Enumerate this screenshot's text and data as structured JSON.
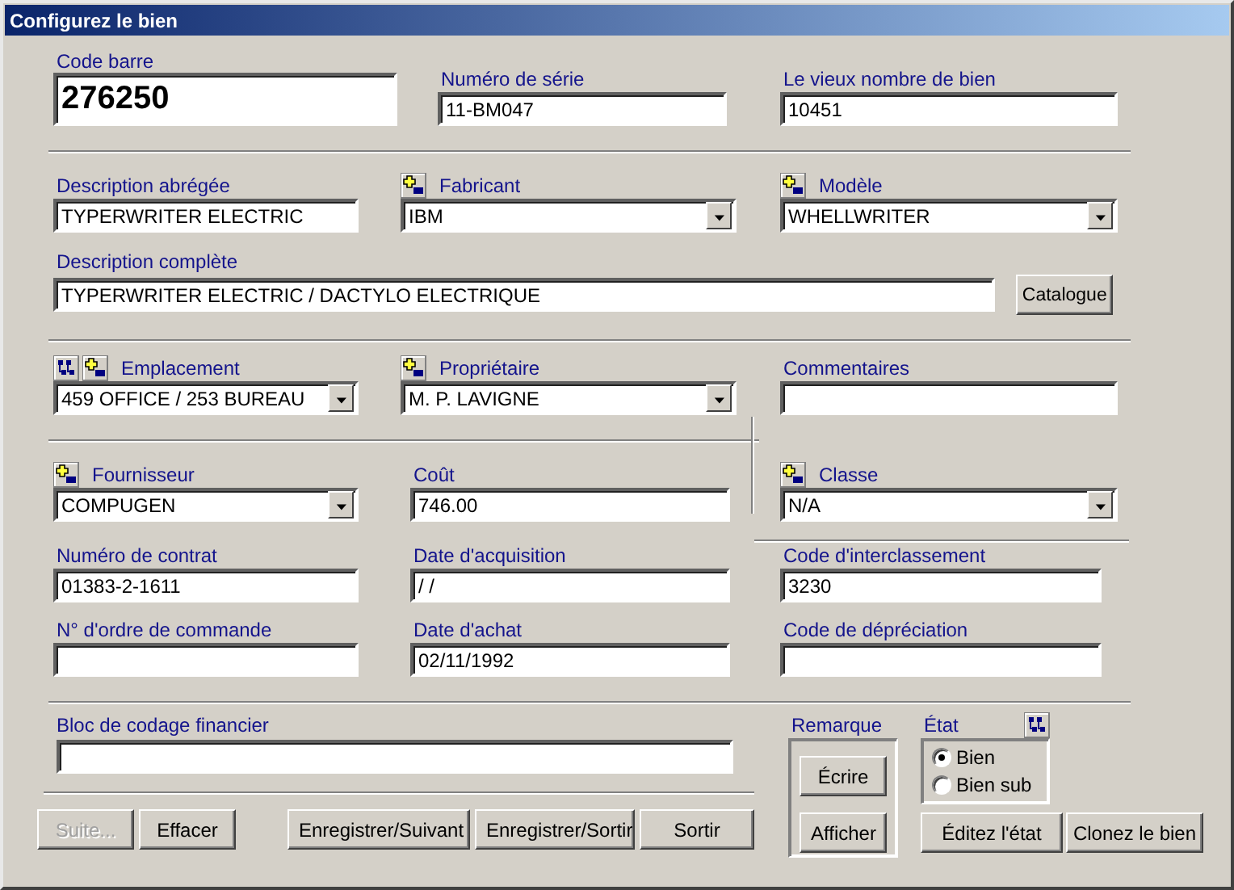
{
  "window": {
    "title": "Configurez le bien"
  },
  "sections": [
    {
      "rows": [
        [
          {
            "label": "Code barre",
            "kind": "barcode",
            "value": "276250"
          },
          {
            "label": "Numéro de série",
            "kind": "text",
            "value": "11-BM047"
          },
          {
            "label": "Le vieux nombre de bien",
            "kind": "text",
            "value": "10451"
          }
        ]
      ]
    },
    {
      "rows": [
        [
          {
            "label": "Description abrégée",
            "kind": "text",
            "value": "TYPERWRITER ELECTRIC"
          },
          {
            "label": "Fabricant",
            "kind": "combo",
            "value": "IBM",
            "add_remove": true
          },
          {
            "label": "Modèle",
            "kind": "combo",
            "value": "WHELLWRITER",
            "add_remove": true
          }
        ],
        [
          {
            "label": "Description complète",
            "kind": "wide",
            "value": "TYPERWRITER ELECTRIC / DACTYLO ELECTRIQUE",
            "button": "Catalogue"
          }
        ]
      ]
    },
    {
      "rows": [
        [
          {
            "label": "Emplacement",
            "kind": "combo",
            "value": "459 OFFICE / 253 BUREAU",
            "hierarchy": true,
            "add_remove": true
          },
          {
            "label": "Propriétaire",
            "kind": "combo",
            "value": "M. P. LAVIGNE",
            "add_remove": true
          },
          {
            "label": "Commentaires",
            "kind": "text"
          }
        ]
      ]
    },
    {
      "rows": [
        [
          {
            "label": "Fournisseur",
            "kind": "combo",
            "value": "COMPUGEN",
            "add_remove": true
          },
          {
            "label": "Coût",
            "kind": "text",
            "value": "746.00"
          },
          {
            "label": "Classe",
            "kind": "combo",
            "value": "N/A",
            "add_remove": true
          }
        ],
        [
          {
            "label": "Numéro de contrat",
            "kind": "text",
            "value": "01383-2-1611"
          },
          {
            "label": "Date d'acquisition",
            "kind": "text",
            "value": " / /"
          },
          {
            "label": "Code d'interclassement",
            "kind": "text",
            "value": "3230"
          }
        ],
        [
          {
            "label": "N° d'ordre de commande",
            "kind": "text"
          },
          {
            "label": "Date d'achat",
            "kind": "text",
            "value": "02/11/1992"
          },
          {
            "label": "Code de dépréciation",
            "kind": "text"
          }
        ]
      ]
    }
  ],
  "financial": {
    "label": "Bloc de codage financier"
  },
  "buttons": [
    {
      "label": "Suite...",
      "disabled": true
    },
    {
      "label": "Effacer",
      "disabled": false
    },
    {
      "label": "Enregistrer/Suivant",
      "disabled": false
    },
    {
      "label": "Enregistrer/Sortir",
      "disabled": false
    },
    {
      "label": "Sortir",
      "disabled": false
    }
  ],
  "remarque": {
    "label": "Remarque",
    "buttons": [
      "Écrire",
      "Afficher"
    ]
  },
  "etat": {
    "label": "État",
    "options": [
      {
        "label": "Bien",
        "selected": true
      },
      {
        "label": "Bien sub",
        "selected": false
      }
    ],
    "button": "Éditez l'état"
  },
  "clone_button": "Clonez le bien"
}
